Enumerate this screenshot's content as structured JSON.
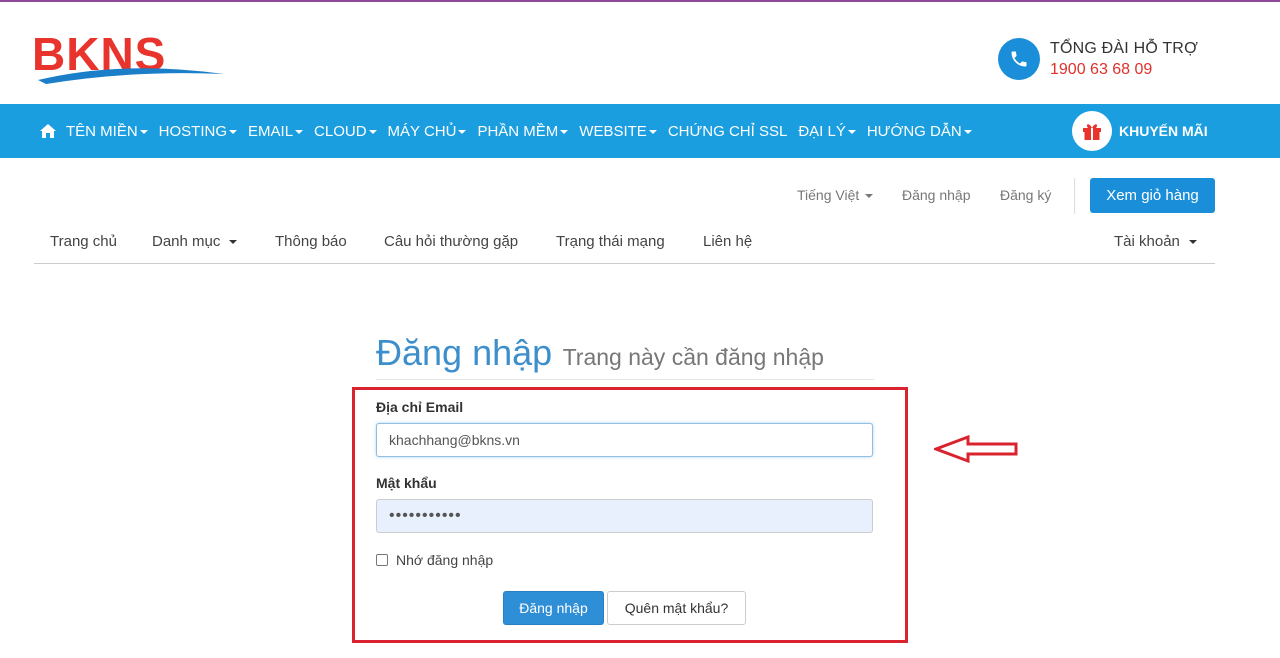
{
  "brand": {
    "logo_text": "BKNS",
    "primary_color": "#1a9ee0",
    "logo_red": "#e8342c",
    "logo_blue": "#1a7ec8"
  },
  "support": {
    "title": "TỔNG ĐÀI HỖ TRỢ",
    "phone": "1900 63 68 09",
    "icon": "phone-icon"
  },
  "nav": {
    "home_icon": "home-icon",
    "items": [
      {
        "label": "TÊN MIỀN",
        "dropdown": true
      },
      {
        "label": "HOSTING",
        "dropdown": true
      },
      {
        "label": "EMAIL",
        "dropdown": true
      },
      {
        "label": "CLOUD",
        "dropdown": true
      },
      {
        "label": "MÁY CHỦ",
        "dropdown": true
      },
      {
        "label": "PHẦN MỀM",
        "dropdown": true
      },
      {
        "label": "WEBSITE",
        "dropdown": true
      },
      {
        "label": "CHỨNG CHỈ SSL",
        "dropdown": false
      },
      {
        "label": "ĐẠI LÝ",
        "dropdown": true
      },
      {
        "label": "HƯỚNG DẪN",
        "dropdown": true
      }
    ],
    "promo": {
      "label": "KHUYẾN MÃI",
      "icon": "gift-icon"
    }
  },
  "utility": {
    "language": "Tiếng Việt",
    "login": "Đăng nhập",
    "register": "Đăng ký",
    "cart_button": "Xem giỏ hàng"
  },
  "subnav": {
    "items": [
      {
        "label": "Trang chủ",
        "dropdown": false
      },
      {
        "label": "Danh mục",
        "dropdown": true
      },
      {
        "label": "Thông báo",
        "dropdown": false
      },
      {
        "label": "Câu hỏi thường gặp",
        "dropdown": false
      },
      {
        "label": "Trạng thái mạng",
        "dropdown": false
      },
      {
        "label": "Liên hệ",
        "dropdown": false
      }
    ],
    "account": "Tài khoản"
  },
  "login": {
    "title": "Đăng nhập",
    "subtitle": "Trang này cần đăng nhập",
    "email_label": "Địa chỉ Email",
    "email_value": "khachhang@bkns.vn",
    "password_label": "Mật khẩu",
    "password_value": "•••••••••••",
    "remember_label": "Nhớ đăng nhập",
    "remember_checked": false,
    "submit_label": "Đăng nhập",
    "forgot_label": "Quên mật khẩu?"
  },
  "annotation": {
    "highlight_color": "#d9232e",
    "arrow_icon": "left-arrow-icon"
  }
}
